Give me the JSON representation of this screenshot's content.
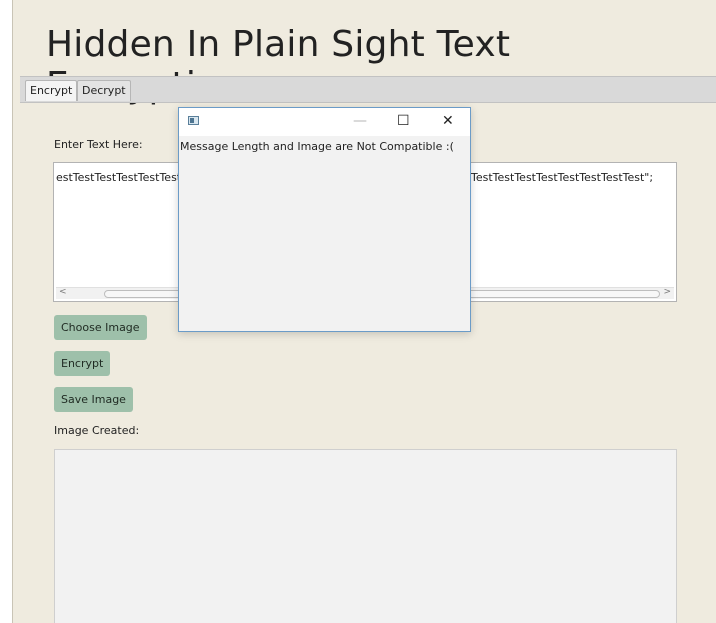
{
  "app": {
    "title": "Hidden In Plain Sight Text Encryption"
  },
  "tabs": [
    {
      "label": "Encrypt",
      "active": true
    },
    {
      "label": "Decrypt",
      "active": false
    }
  ],
  "encrypt": {
    "input_label": "Enter Text Here:",
    "input_visible_left": "estTestTestTestTestTestT",
    "input_visible_right": "TestTestTestTestTestTestTestTest\";",
    "choose_image_label": "Choose Image",
    "encrypt_label": "Encrypt",
    "save_image_label": "Save Image",
    "output_label": "Image Created:"
  },
  "dialog": {
    "title": "",
    "minimize_glyph": "—",
    "maximize_glyph": "☐",
    "close_glyph": "✕",
    "message": "Message Length and Image are Not Compatible :("
  },
  "colors": {
    "background": "#efebdf",
    "button": "#9ec0aa",
    "dialog_border": "#6b9bc7"
  }
}
